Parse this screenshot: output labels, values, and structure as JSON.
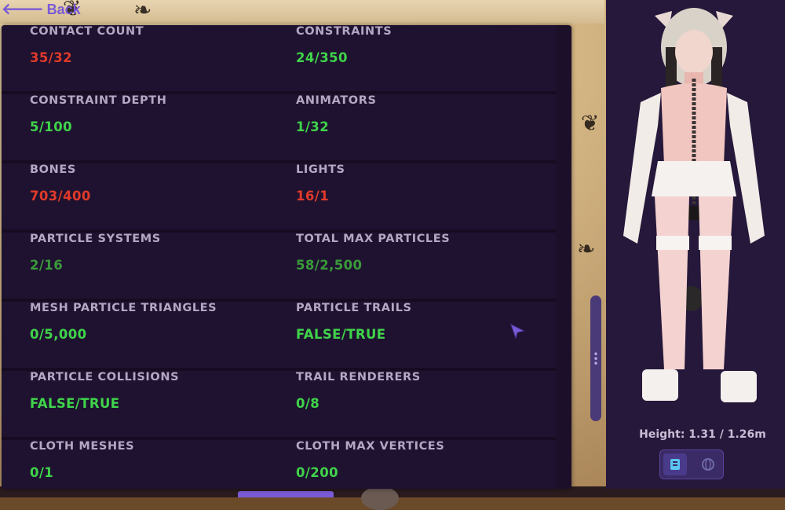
{
  "nav": {
    "back_label": "Back"
  },
  "stats": {
    "rows": [
      {
        "left": {
          "label": "CONTACT COUNT",
          "value": "35/32",
          "status": "red"
        },
        "right": {
          "label": "CONSTRAINTS",
          "value": "24/350",
          "status": "green"
        }
      },
      {
        "left": {
          "label": "CONSTRAINT DEPTH",
          "value": "5/100",
          "status": "green"
        },
        "right": {
          "label": "ANIMATORS",
          "value": "1/32",
          "status": "green"
        }
      },
      {
        "left": {
          "label": "BONES",
          "value": "703/400",
          "status": "red"
        },
        "right": {
          "label": "LIGHTS",
          "value": "16/1",
          "status": "red"
        }
      },
      {
        "left": {
          "label": "PARTICLE SYSTEMS",
          "value": "2/16",
          "status": "dark-green"
        },
        "right": {
          "label": "TOTAL MAX PARTICLES",
          "value": "58/2,500",
          "status": "dark-green"
        }
      },
      {
        "left": {
          "label": "MESH PARTICLE TRIANGLES",
          "value": "0/5,000",
          "status": "green"
        },
        "right": {
          "label": "PARTICLE TRAILS",
          "value": "FALSE/TRUE",
          "status": "green"
        }
      },
      {
        "left": {
          "label": "PARTICLE COLLISIONS",
          "value": "FALSE/TRUE",
          "status": "green"
        },
        "right": {
          "label": "TRAIL RENDERERS",
          "value": "0/8",
          "status": "green"
        }
      },
      {
        "left": {
          "label": "CLOTH MESHES",
          "value": "0/1",
          "status": "green"
        },
        "right": {
          "label": "CLOTH MAX VERTICES",
          "value": "0/200",
          "status": "green"
        }
      }
    ]
  },
  "avatar": {
    "height_label": "Height: 1.31 / 1.26m",
    "view_buttons": [
      {
        "icon": "details-icon",
        "active": true
      },
      {
        "icon": "globe-icon",
        "active": false
      }
    ]
  },
  "colors": {
    "accent": "#7a5ad6",
    "red": "#e03a2a",
    "green": "#3fd44a",
    "dark_green": "#3a9a3a",
    "label": "#b4a7c3",
    "panel_bg": "#1c0f2a"
  }
}
